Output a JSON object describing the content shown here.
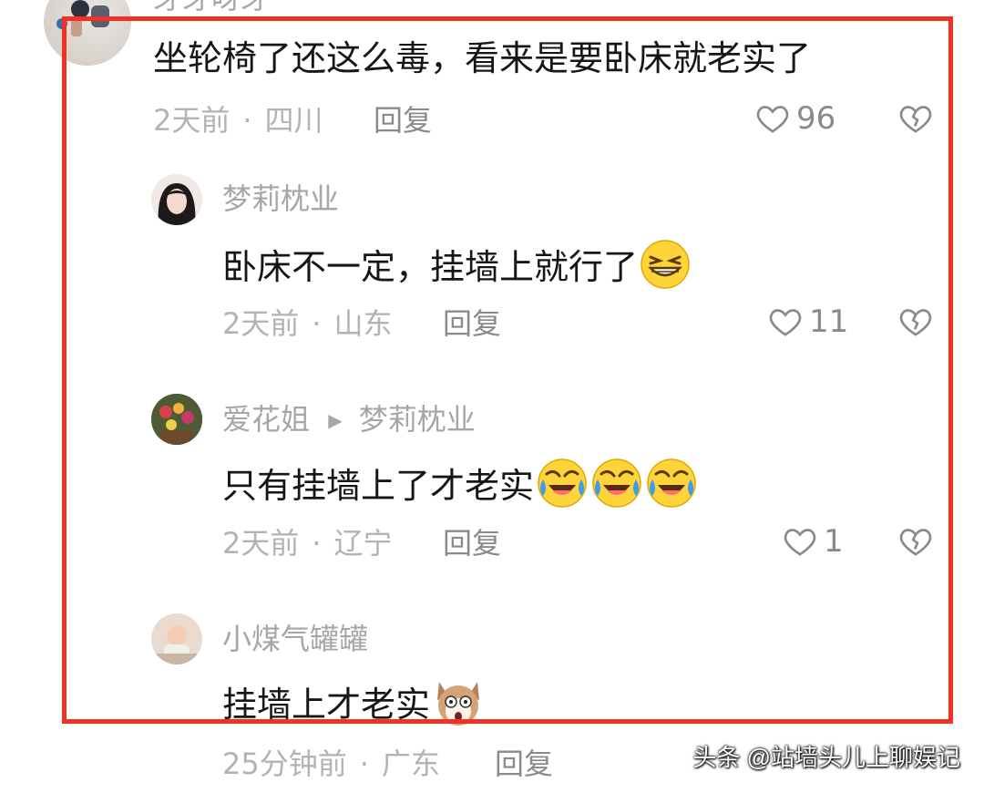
{
  "top_comment": {
    "username_cropped": "牙牙呀牙",
    "text": "坐轮椅了还这么毒，看来是要卧床就老实了",
    "time": "2天前",
    "location": "四川",
    "reply_label": "回复",
    "likes": "96"
  },
  "replies": [
    {
      "username": "梦莉枕业",
      "reply_to": "",
      "text": "卧床不一定，挂墙上就行了",
      "emojis": [
        "grin-squint-emoji"
      ],
      "time": "2天前",
      "location": "山东",
      "reply_label": "回复",
      "likes": "11"
    },
    {
      "username": "爱花姐",
      "reply_to": "梦莉枕业",
      "text": "只有挂墙上了才老实",
      "emojis": [
        "rofl-emoji",
        "rofl-emoji",
        "rofl-emoji"
      ],
      "time": "2天前",
      "location": "辽宁",
      "reply_label": "回复",
      "likes": "1"
    },
    {
      "username": "小煤气罐罐",
      "reply_to": "",
      "text": "挂墙上才老实",
      "emojis": [
        "shocked-dog-emoji"
      ],
      "time": "25分钟前",
      "location": "广东",
      "reply_label": "回复",
      "likes": ""
    }
  ],
  "watermark": "头条 @站墙头儿上聊娱记",
  "colors": {
    "highlight": "#f03226",
    "text": "#161616",
    "muted": "#b3b3b3"
  }
}
